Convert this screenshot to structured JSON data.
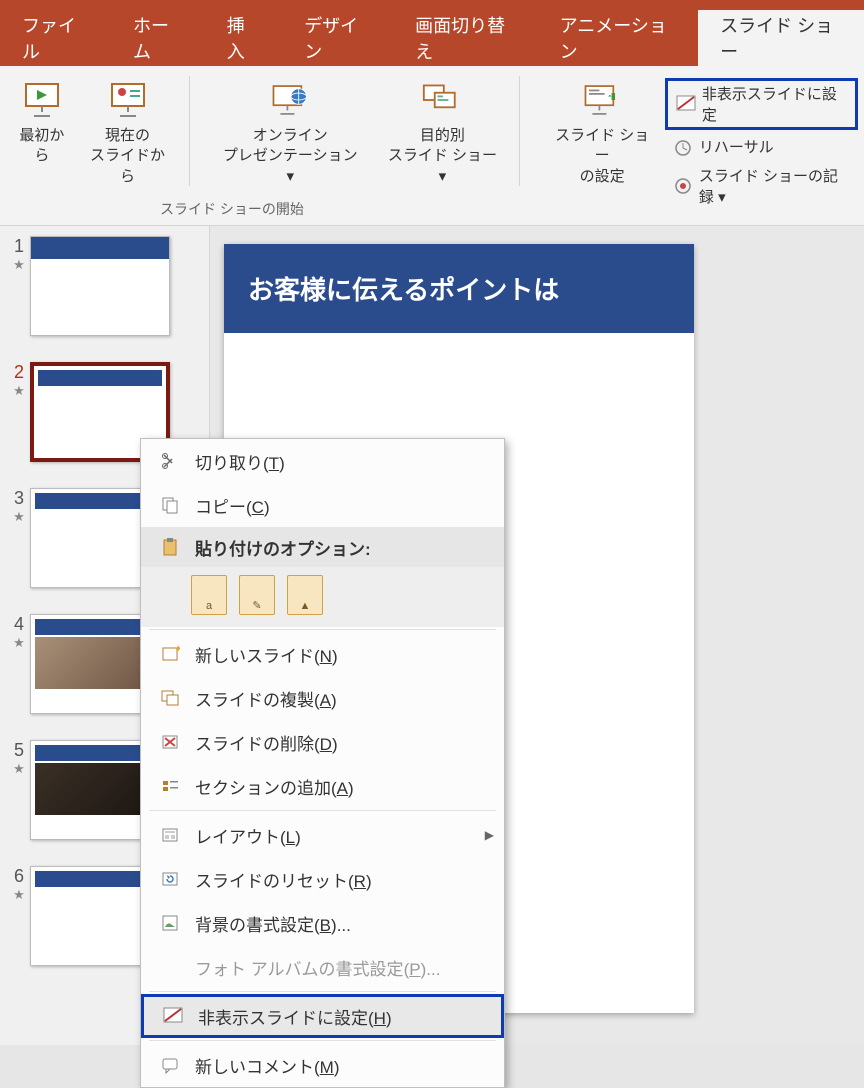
{
  "tabs": {
    "file": "ファイル",
    "home": "ホーム",
    "insert": "挿入",
    "design": "デザイン",
    "transitions": "画面切り替え",
    "animations": "アニメーション",
    "slideshow": "スライド ショー"
  },
  "ribbon": {
    "from_beginning": "最初から",
    "from_current_l1": "現在の",
    "from_current_l2": "スライドから",
    "online_l1": "オンライン",
    "online_l2": "プレゼンテーション",
    "custom_l1": "目的別",
    "custom_l2": "スライド ショー",
    "setup_l1": "スライド ショー",
    "setup_l2": "の設定",
    "hide_slide": "非表示スライドに設定",
    "rehearse": "リハーサル",
    "record": "スライド ショーの記録",
    "group_start": "スライド ショーの開始"
  },
  "thumbs": [
    {
      "num": "1"
    },
    {
      "num": "2"
    },
    {
      "num": "3"
    },
    {
      "num": "4"
    },
    {
      "num": "5"
    },
    {
      "num": "6"
    }
  ],
  "slide": {
    "title": "お客様に伝えるポイントは"
  },
  "context": {
    "cut": "切り取り",
    "cut_k": "T",
    "copy": "コピー",
    "copy_k": "C",
    "paste_options": "貼り付けのオプション:",
    "new_slide": "新しいスライド",
    "new_slide_k": "N",
    "duplicate": "スライドの複製",
    "duplicate_k": "A",
    "delete": "スライドの削除",
    "delete_k": "D",
    "add_section": "セクションの追加",
    "add_section_k": "A",
    "layout": "レイアウト",
    "layout_k": "L",
    "reset": "スライドのリセット",
    "reset_k": "R",
    "format_bg": "背景の書式設定",
    "format_bg_k": "B",
    "format_bg_suffix": "...",
    "photo_album": "フォト アルバムの書式設定",
    "photo_album_k": "P",
    "photo_album_suffix": "...",
    "hide_slide": "非表示スライドに設定",
    "hide_slide_k": "H",
    "new_comment": "新しいコメント",
    "new_comment_k": "M"
  }
}
